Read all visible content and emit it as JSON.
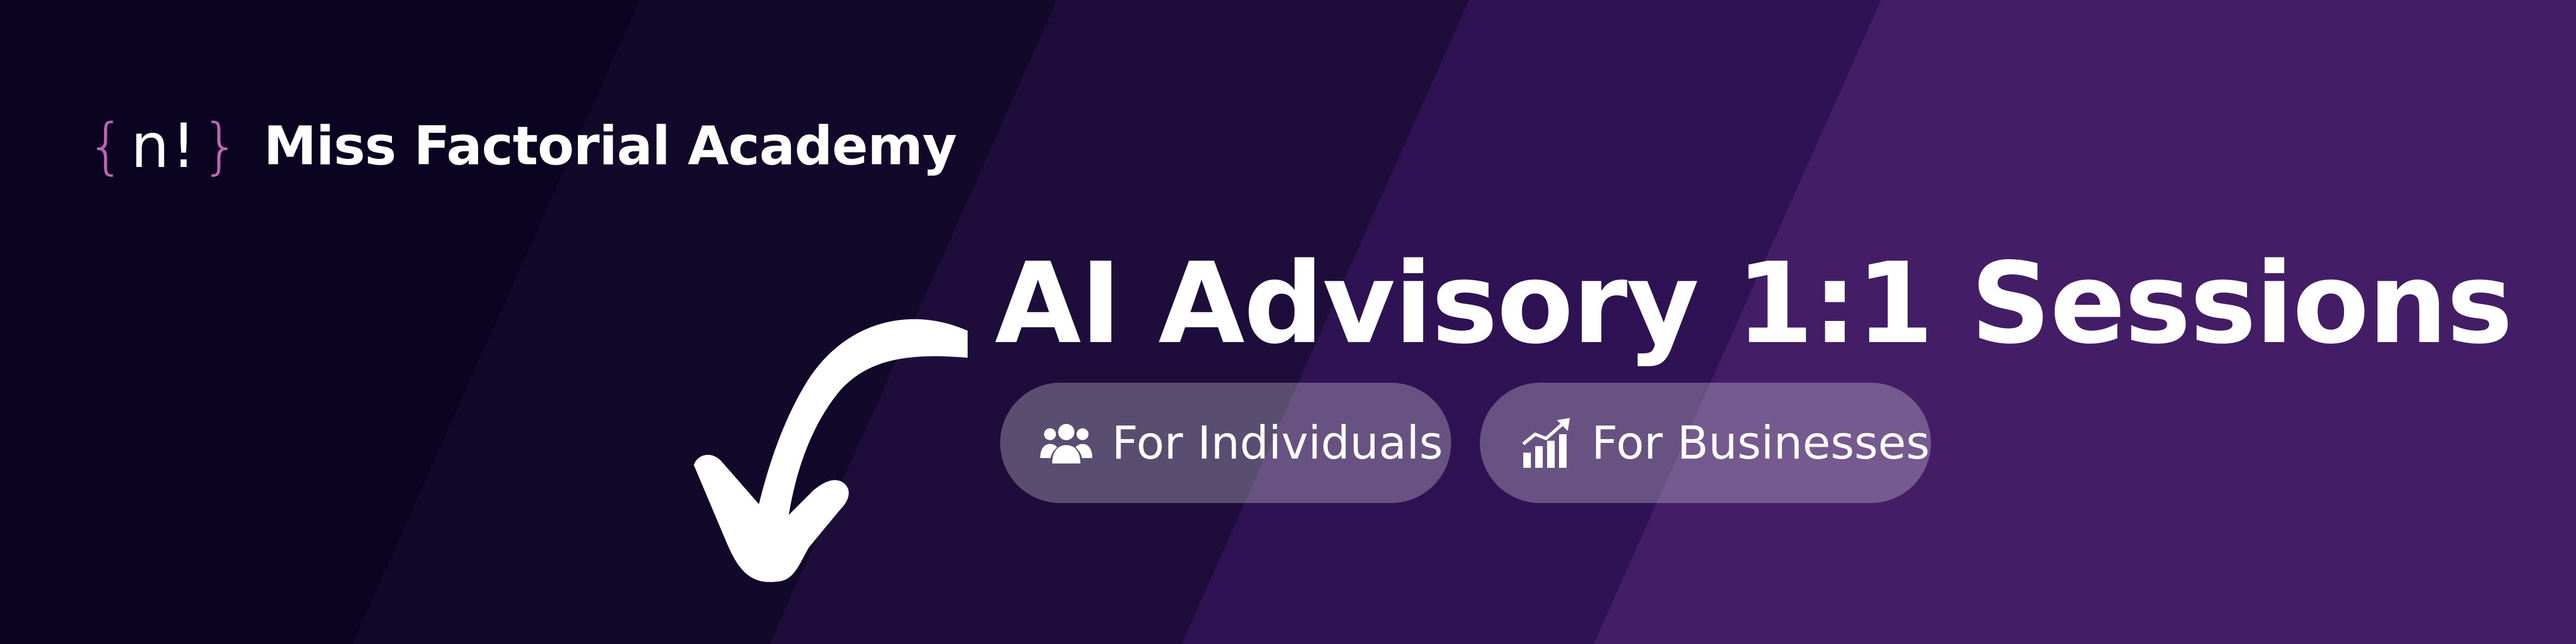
{
  "brand": {
    "logo_open": "{",
    "logo_core": "n!",
    "logo_close": "}",
    "name": "Miss Factorial Academy"
  },
  "hero": {
    "title": "AI Advisory 1:1 Sessions"
  },
  "options": [
    {
      "label": "For Individuals",
      "icon": "people-icon"
    },
    {
      "label": "For Businesses",
      "icon": "growth-chart-icon"
    }
  ],
  "decor": {
    "arrow_icon": "curved-arrow-icon"
  },
  "colors": {
    "background_dark": "#0d0625",
    "background_mid": "#1e0d3d",
    "background_violet": "#33135a",
    "background_light": "#482069",
    "logo_brace": "#c064b8",
    "text": "#ffffff"
  }
}
